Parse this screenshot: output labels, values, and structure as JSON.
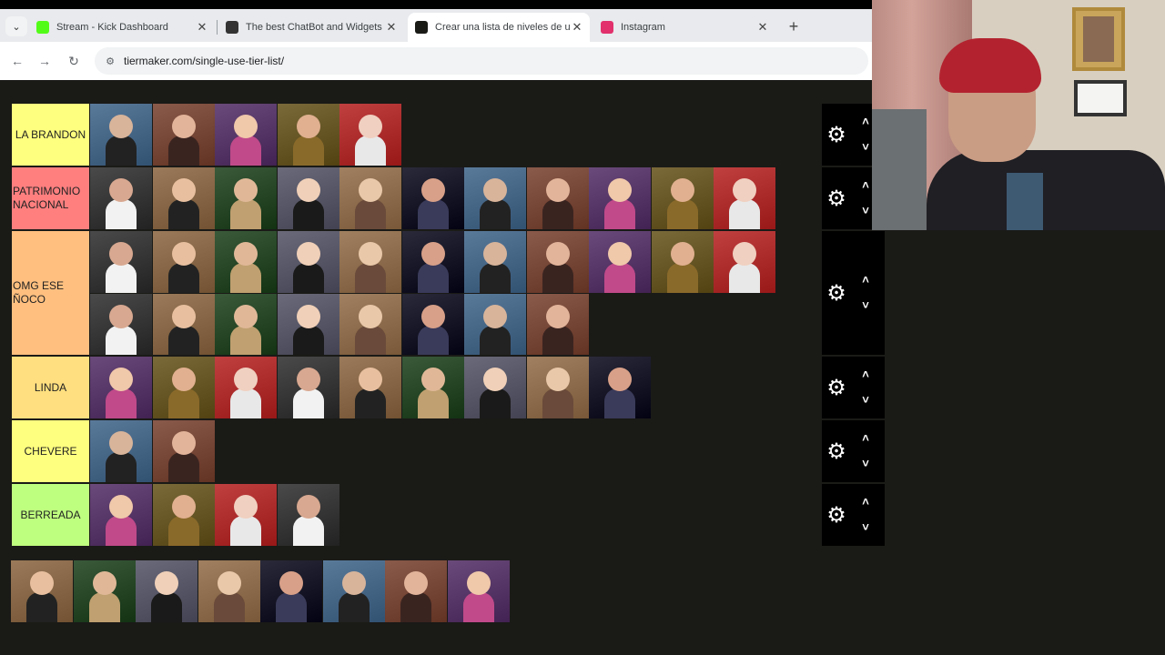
{
  "browser": {
    "tabs": [
      {
        "title": "Stream - Kick Dashboard",
        "favicon_color": "#53fc18",
        "icon": "kick-icon",
        "active": false
      },
      {
        "title": "The best ChatBot and Widgets f",
        "favicon_color": "#333333",
        "icon": "botrix-icon",
        "active": false
      },
      {
        "title": "Crear una lista de niveles de un",
        "favicon_color": "#1a1a17",
        "icon": "tiermaker-icon",
        "active": true
      },
      {
        "title": "Instagram",
        "favicon_color": "#e1306c",
        "icon": "instagram-icon",
        "active": false
      }
    ],
    "url": "tiermaker.com/single-use-tier-list/"
  },
  "tiers": [
    {
      "label": "LA BRANDON",
      "color": "#ffff7f",
      "items": 5,
      "align": "center"
    },
    {
      "label": "PATRIMONIO NACIONAL",
      "color": "#ff7f7f",
      "items": 11,
      "align": "left"
    },
    {
      "label": "OMG ESE ÑOCO",
      "color": "#ffbf7f",
      "items": 19,
      "align": "left"
    },
    {
      "label": "LINDA",
      "color": "#ffdf7f",
      "items": 9,
      "align": "center"
    },
    {
      "label": "CHEVERE",
      "color": "#ffff7f",
      "items": 2,
      "align": "center"
    },
    {
      "label": "BERREADA",
      "color": "#bfff7f",
      "items": 4,
      "align": "center"
    }
  ],
  "unranked_items": 8,
  "colors": {
    "page_bg": "#1a1a17",
    "control_bg": "#000000"
  }
}
